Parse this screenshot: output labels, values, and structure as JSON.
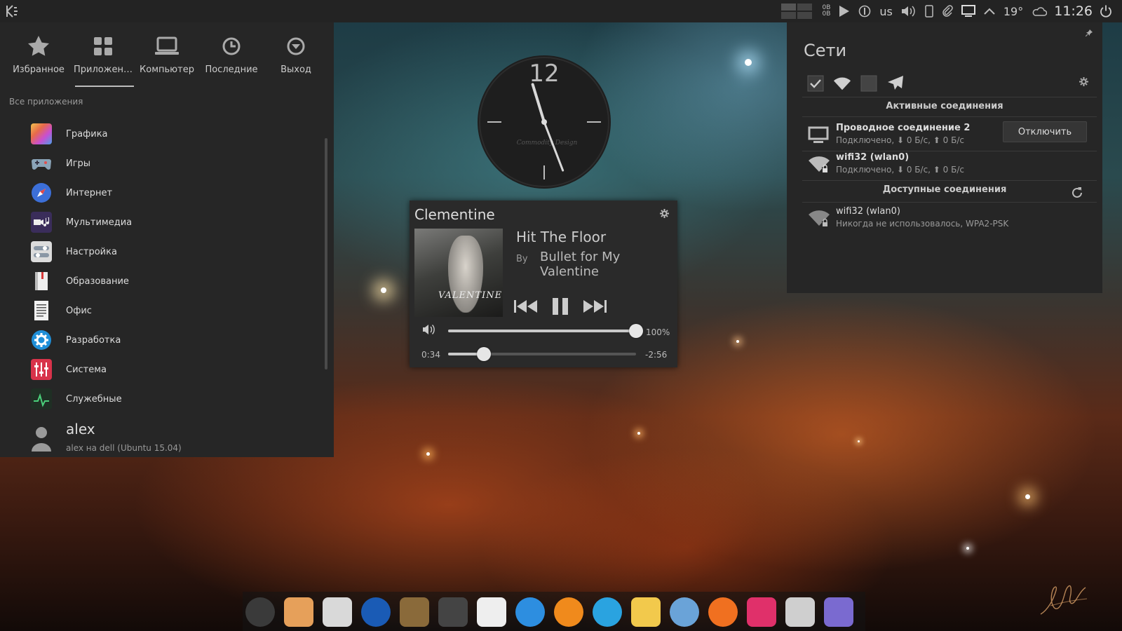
{
  "top_panel": {
    "net_rate_up": "0B",
    "net_rate_down": "0B",
    "keyboard_layout": "us",
    "temperature": "19°",
    "clock": "11:26"
  },
  "launcher": {
    "tabs": [
      {
        "label": "Избранное",
        "icon": "star-icon"
      },
      {
        "label": "Приложен…",
        "icon": "grid-icon"
      },
      {
        "label": "Компьютер",
        "icon": "laptop-icon"
      },
      {
        "label": "Последние",
        "icon": "history-icon"
      },
      {
        "label": "Выход",
        "icon": "power-down-icon"
      }
    ],
    "active_tab": 1,
    "section_label": "Все приложения",
    "apps": [
      {
        "label": "Графика",
        "icon": "graphics-icon"
      },
      {
        "label": "Игры",
        "icon": "gamepad-icon"
      },
      {
        "label": "Интернет",
        "icon": "compass-icon"
      },
      {
        "label": "Мультимедиа",
        "icon": "multimedia-icon"
      },
      {
        "label": "Настройка",
        "icon": "settings-toggle-icon"
      },
      {
        "label": "Образование",
        "icon": "book-icon"
      },
      {
        "label": "Офис",
        "icon": "document-icon"
      },
      {
        "label": "Разработка",
        "icon": "gear-icon"
      },
      {
        "label": "Система",
        "icon": "mixer-icon"
      },
      {
        "label": "Служебные",
        "icon": "utilities-icon"
      }
    ],
    "user": {
      "name": "alex",
      "host": "alex на dell (Ubuntu 15.04)"
    }
  },
  "clock_widget": {
    "numeral_12": "12",
    "brand": "Commodity Design",
    "hour": 11,
    "minute": 26,
    "second": 29
  },
  "player": {
    "app_title": "Clementine",
    "song": "Hit The Floor",
    "by_label": "By",
    "artist": "Bullet for My Valentine",
    "album_text": "VALENTINE",
    "volume_percent": 100,
    "volume_label": "100%",
    "elapsed": "0:34",
    "remaining": "-2:56",
    "progress_fraction": 0.19
  },
  "networks": {
    "title": "Сети",
    "active_header": "Активные соединения",
    "available_header": "Доступные соединения",
    "active": [
      {
        "name": "Проводное соединение 2",
        "status": "Подключено, ⬇ 0 Б/с, ⬆ 0 Б/с",
        "icon": "monitor-icon",
        "button": "Отключить"
      },
      {
        "name": "wifi32 (wlan0)",
        "status": "Подключено, ⬇ 0 Б/с, ⬆ 0 Б/с",
        "icon": "wifi-lock-icon"
      }
    ],
    "available": [
      {
        "name": "wifi32 (wlan0)",
        "status": "Никогда не использовалось, WPA2-PSK",
        "icon": "wifi-lock-icon"
      }
    ]
  },
  "dock": {
    "items": [
      {
        "name": "github-icon",
        "color": "#3a3a3a"
      },
      {
        "name": "download-icon",
        "color": "#e6a05a"
      },
      {
        "name": "settings-icon",
        "color": "#d9d9d9"
      },
      {
        "name": "browser-globe-icon",
        "color": "#1a5bb5"
      },
      {
        "name": "bird-app-icon",
        "color": "#8a6a3a"
      },
      {
        "name": "inkscape-icon",
        "color": "#444444"
      },
      {
        "name": "text-editor-icon",
        "color": "#eeeeee"
      },
      {
        "name": "spiral-app-icon",
        "color": "#2d8ee0"
      },
      {
        "name": "rss-icon",
        "color": "#f08a1c"
      },
      {
        "name": "telegram-icon",
        "color": "#2aa3e0"
      },
      {
        "name": "mail-icon",
        "color": "#f2c94c"
      },
      {
        "name": "chromium-icon",
        "color": "#6aa3d8"
      },
      {
        "name": "headphones-icon",
        "color": "#f07020"
      },
      {
        "name": "media-player-icon",
        "color": "#e0306a"
      },
      {
        "name": "files-icon",
        "color": "#cfcfcf"
      },
      {
        "name": "cursor-app-icon",
        "color": "#7a6ad0"
      }
    ]
  }
}
